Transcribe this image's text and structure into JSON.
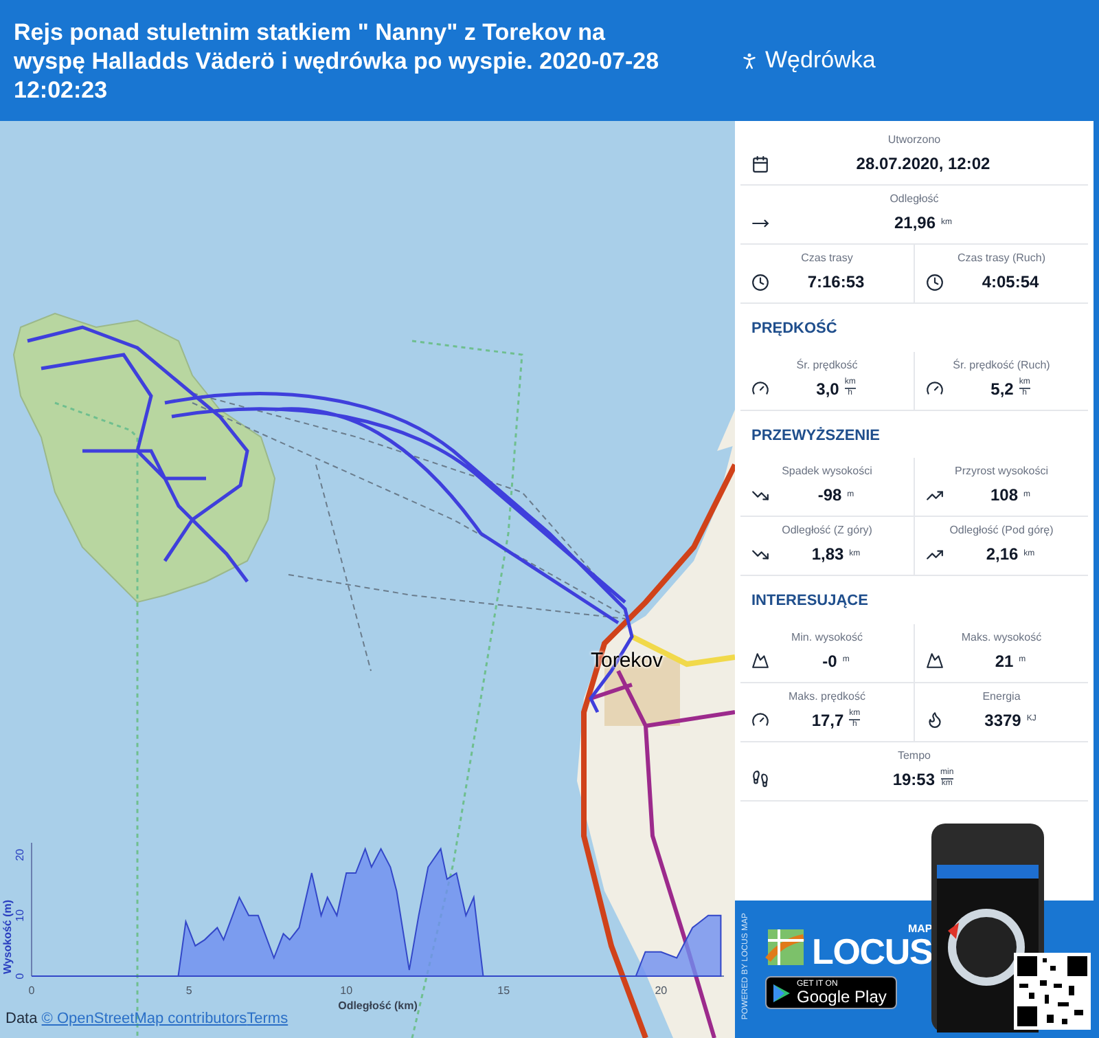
{
  "header": {
    "title": "Rejs ponad stuletnim statkiem \" Nanny\" z Torekov na wyspę Halladds Väderö i wędrówka po wyspie. 2020-07-28 12:02:23",
    "activity": "Wędrówka"
  },
  "map": {
    "place_label": "Torekov",
    "attribution": {
      "prefix": "Data ",
      "link": "© OpenStreetMap contributors",
      "terms": "Terms"
    },
    "elevation": {
      "chart_data": {
        "type": "area",
        "xlabel": "Odległość (km)",
        "ylabel": "Wysokość (m)",
        "xlim": [
          0,
          22
        ],
        "ylim": [
          0,
          22
        ],
        "xticks": [
          0,
          5,
          10,
          15,
          20
        ],
        "yticks": [
          0,
          10,
          20
        ],
        "x": [
          0,
          4.5,
          4.66,
          4.9,
          5.2,
          5.5,
          5.9,
          6.1,
          6.6,
          6.9,
          7.2,
          7.7,
          8.0,
          8.2,
          8.5,
          8.9,
          9.2,
          9.4,
          9.7,
          10.0,
          10.3,
          10.6,
          10.8,
          11.1,
          11.4,
          11.6,
          12.0,
          12.3,
          12.6,
          13.0,
          13.2,
          13.5,
          13.8,
          14.05,
          14.35,
          15,
          19.2,
          19.5,
          20.0,
          20.5,
          21.0,
          21.5,
          21.9
        ],
        "series": [
          {
            "color": "#6f8ff0",
            "values": [
              0,
              0,
              0,
              9,
              5,
              6,
              8,
              6,
              13,
              10,
              10,
              3,
              7,
              6,
              8,
              17,
              10,
              13,
              10,
              17,
              17,
              21,
              18,
              21,
              18,
              14,
              1,
              10,
              18,
              21,
              16,
              17,
              10,
              13,
              0,
              0,
              0,
              4,
              4,
              3,
              8,
              10,
              10
            ]
          }
        ]
      }
    }
  },
  "stats": [
    {
      "rows": [
        [
          {
            "label": "Utworzono",
            "value": "28.07.2020, 12:02"
          }
        ],
        [
          {
            "label": "Odległość",
            "value": "21,96",
            "unit": "km"
          }
        ],
        [
          {
            "label": "Czas trasy",
            "value": "7:16:53"
          },
          {
            "label": "Czas trasy (Ruch)",
            "value": "4:05:54"
          }
        ]
      ]
    },
    {
      "title": "PRĘDKOŚĆ",
      "rows": [
        [
          {
            "label": "Śr. prędkość",
            "value": "3,0",
            "unit_top": "km",
            "unit_bottom": "h"
          },
          {
            "label": "Śr. prędkość (Ruch)",
            "value": "5,2",
            "unit_top": "km",
            "unit_bottom": "h"
          }
        ]
      ]
    },
    {
      "title": "PRZEWYŻSZENIE",
      "rows": [
        [
          {
            "label": "Spadek wysokości",
            "value": "-98",
            "unit": "m"
          },
          {
            "label": "Przyrost wysokości",
            "value": "108",
            "unit": "m"
          }
        ],
        [
          {
            "label": "Odległość (Z góry)",
            "value": "1,83",
            "unit": "km"
          },
          {
            "label": "Odległość (Pod górę)",
            "value": "2,16",
            "unit": "km"
          }
        ]
      ]
    },
    {
      "title": "INTERESUJĄCE",
      "rows": [
        [
          {
            "label": "Min. wysokość",
            "value": "-0",
            "unit": "m"
          },
          {
            "label": "Maks. wysokość",
            "value": "21",
            "unit": "m"
          }
        ],
        [
          {
            "label": "Maks. prędkość",
            "value": "17,7",
            "unit_top": "km",
            "unit_bottom": "h"
          },
          {
            "label": "Energia",
            "value": "3379",
            "unit": "KJ"
          }
        ],
        [
          {
            "label": "Tempo",
            "value": "19:53",
            "unit_top": "min",
            "unit_bottom": "km"
          }
        ]
      ]
    }
  ],
  "promo": {
    "powered_by": "POWERED BY LOCUS MAP",
    "logo_small": "MAP",
    "logo": "LOCUS",
    "store_small": "GET IT ON",
    "store": "Google Play"
  }
}
